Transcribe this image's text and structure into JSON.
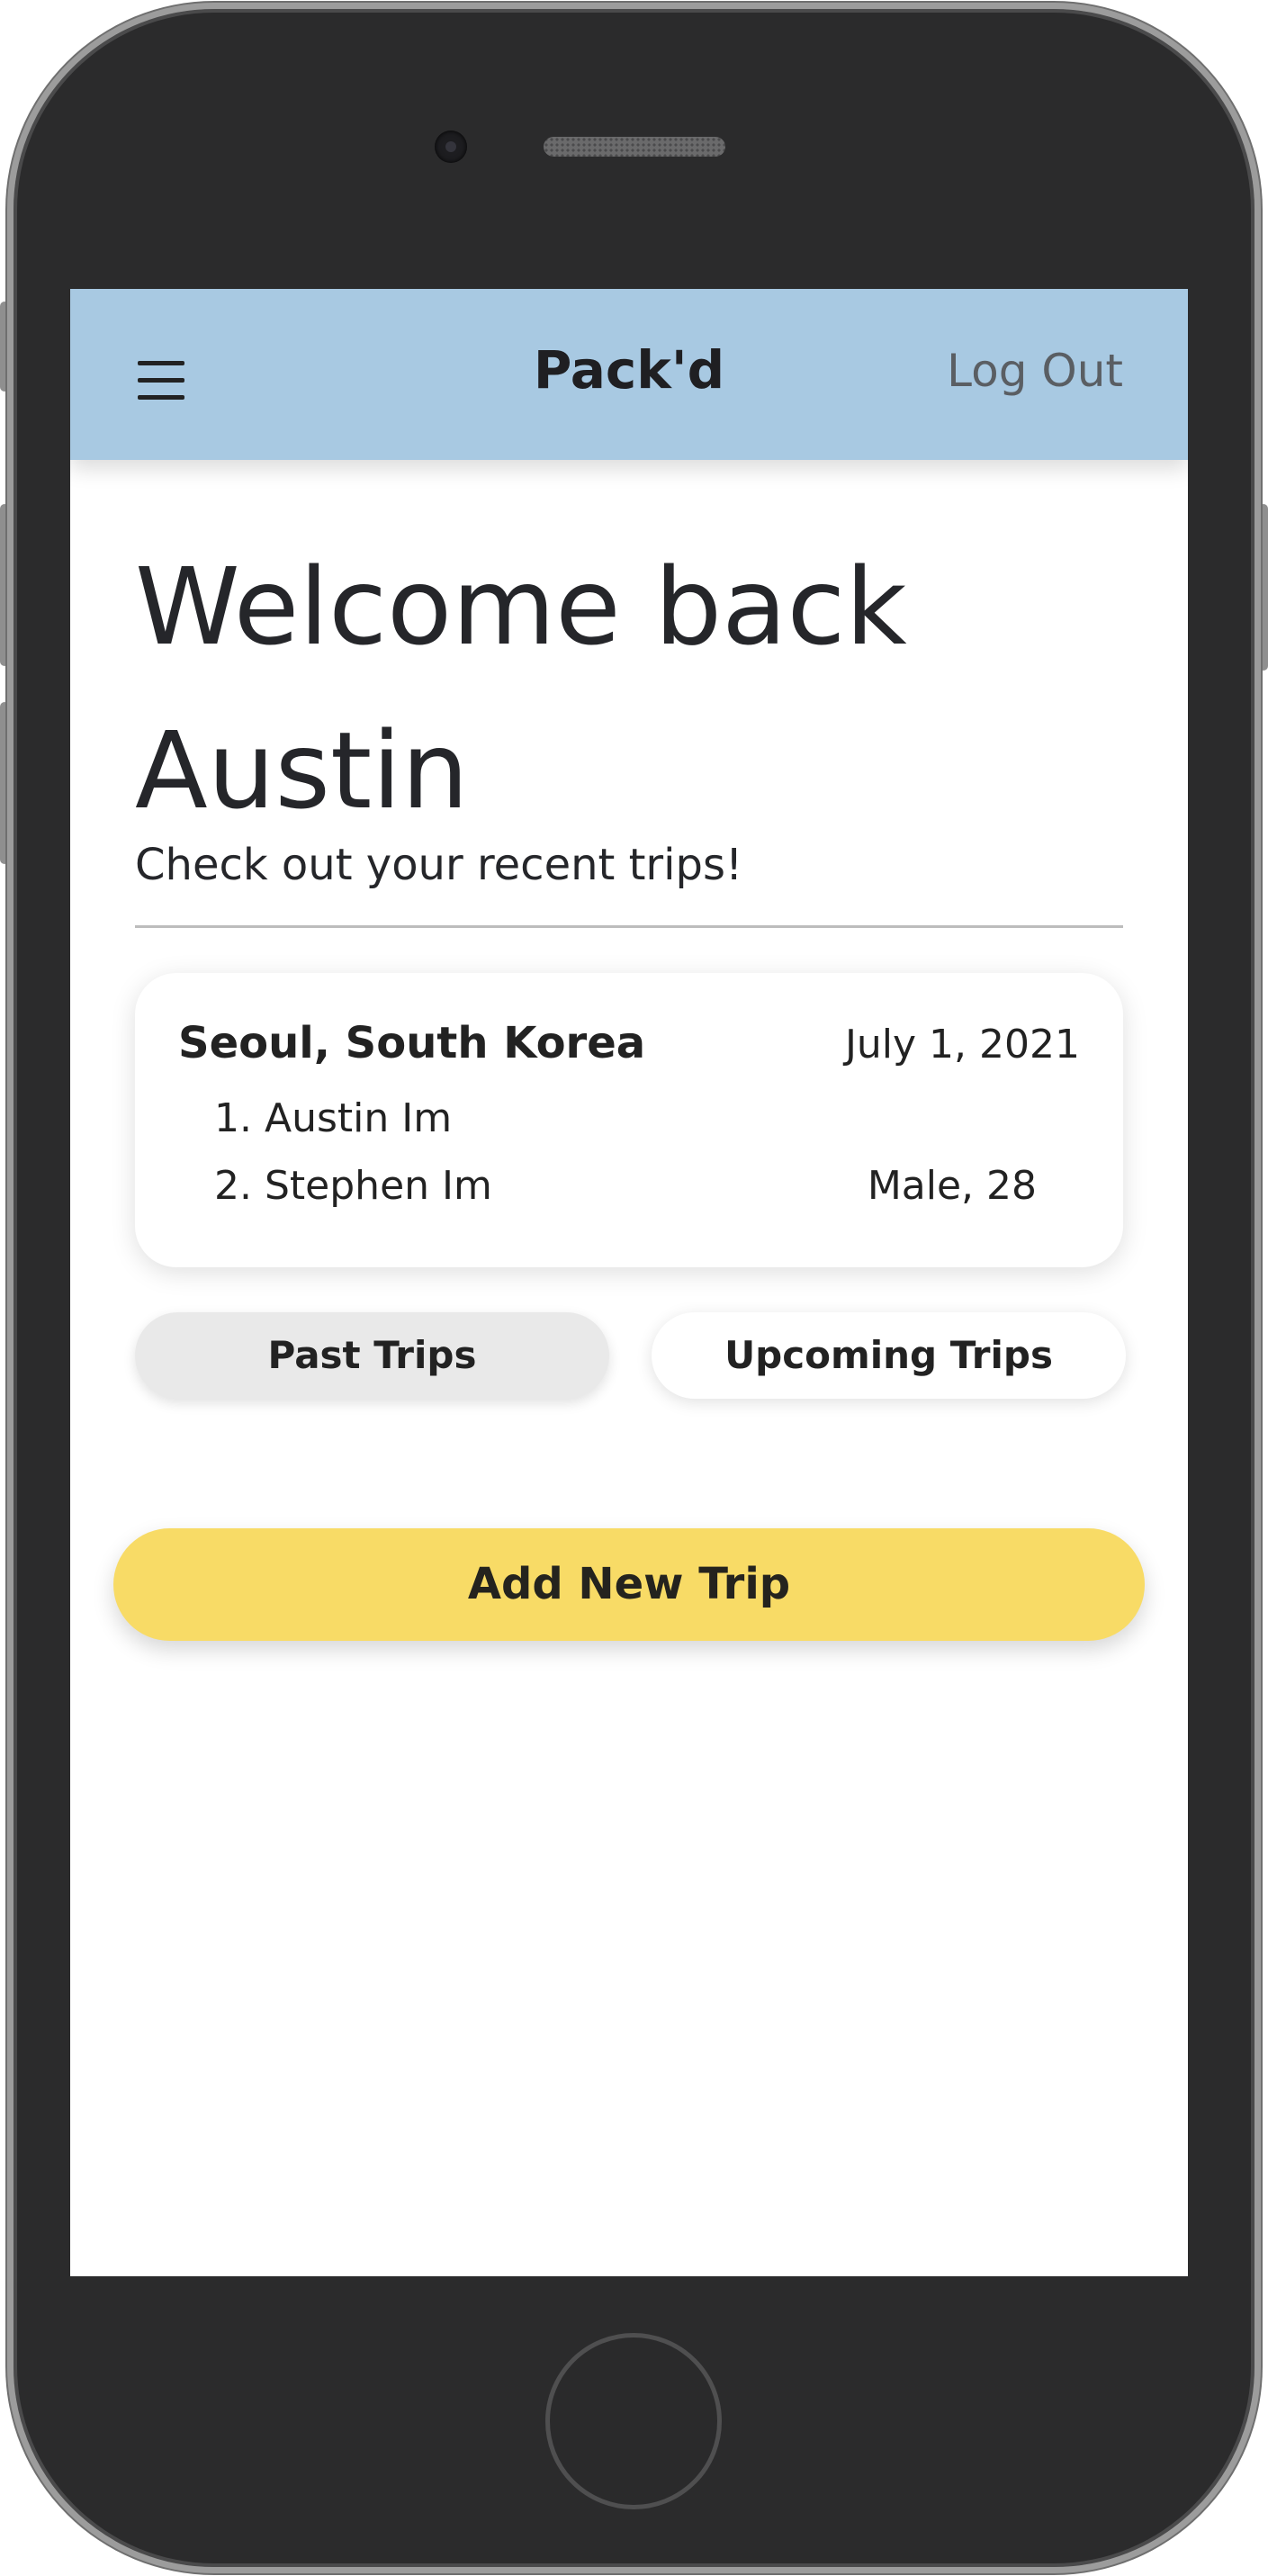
{
  "navbar": {
    "brand": "Pack'd",
    "logout_label": "Log Out"
  },
  "welcome": {
    "heading": "Welcome back Austin",
    "subtitle": "Check out your recent trips!"
  },
  "trip_card": {
    "destination": "Seoul, South Korea",
    "date": "July 1, 2021",
    "travelers": [
      {
        "number": "1.",
        "name": "Austin Im",
        "details": ""
      },
      {
        "number": "2.",
        "name": "Stephen Im",
        "details": "Male,  28"
      }
    ]
  },
  "tabs": {
    "past_label": "Past Trips",
    "upcoming_label": "Upcoming Trips"
  },
  "add_trip_label": "Add New Trip",
  "colors": {
    "navbar_bg": "#a8c9e2",
    "accent_button": "#f8db66",
    "past_tab_bg": "#e9e9e9",
    "device_frame": "#2b2b2c"
  },
  "icons": {
    "menu": "hamburger-menu-icon"
  }
}
